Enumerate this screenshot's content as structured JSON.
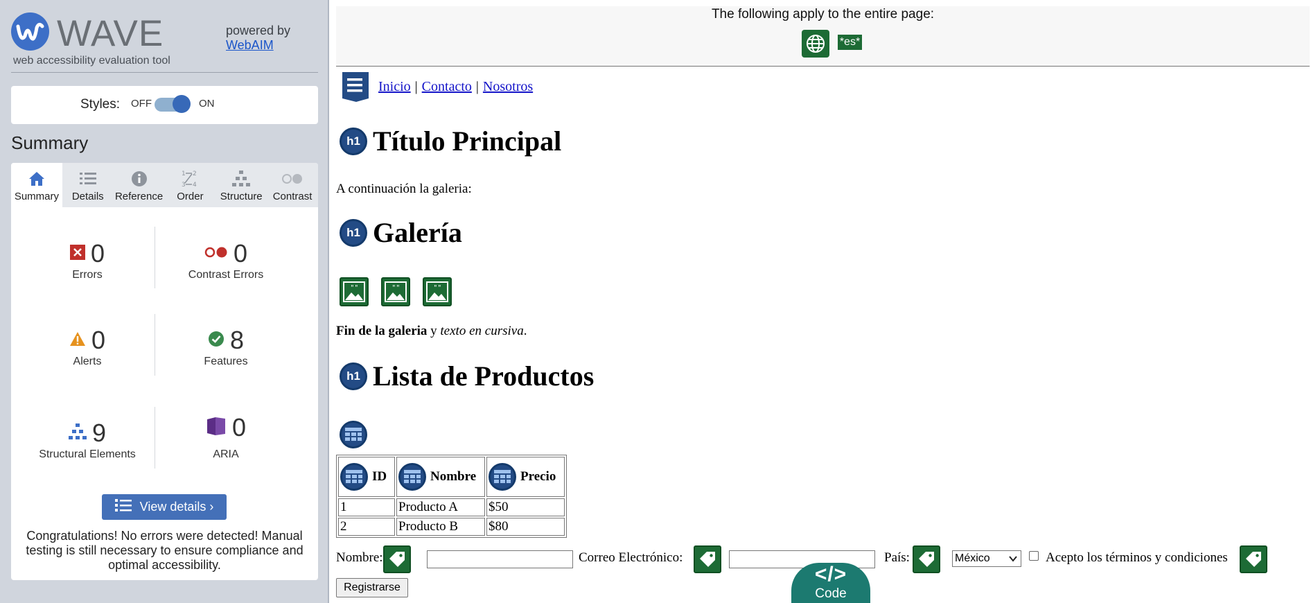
{
  "sidebar": {
    "logo_text": "WAVE",
    "tagline": "web accessibility evaluation tool",
    "powered_by": "powered by",
    "webaim_link": "WebAIM",
    "styles": {
      "label": "Styles:",
      "off": "OFF",
      "on": "ON",
      "state": "on"
    },
    "summary_heading": "Summary",
    "tabs": [
      {
        "label": "Summary",
        "icon": "home-icon",
        "active": true
      },
      {
        "label": "Details",
        "icon": "list-icon",
        "active": false
      },
      {
        "label": "Reference",
        "icon": "info-icon",
        "active": false
      },
      {
        "label": "Order",
        "icon": "order-icon",
        "active": false
      },
      {
        "label": "Structure",
        "icon": "structure-icon",
        "active": false
      },
      {
        "label": "Contrast",
        "icon": "contrast-icon",
        "active": false
      }
    ],
    "stats": {
      "errors": {
        "value": "0",
        "label": "Errors",
        "icon": "error-icon",
        "color": "#c0302b"
      },
      "contrast_errors": {
        "value": "0",
        "label": "Contrast Errors",
        "icon": "contrast-error-icon",
        "color": "#c0302b"
      },
      "alerts": {
        "value": "0",
        "label": "Alerts",
        "icon": "alert-icon",
        "color": "#e6921e"
      },
      "features": {
        "value": "8",
        "label": "Features",
        "icon": "feature-icon",
        "color": "#3a8a4e"
      },
      "structural": {
        "value": "9",
        "label": "Structural Elements",
        "icon": "structure-icon",
        "color": "#3d6fc7"
      },
      "aria": {
        "value": "0",
        "label": "ARIA",
        "icon": "aria-icon",
        "color": "#5b2d86"
      }
    },
    "view_details": "View details ›",
    "congrats": "Congratulations! No errors were detected! Manual testing is still necessary to ensure compliance and optimal accessibility."
  },
  "page": {
    "banner_text": "The following apply to the entire page:",
    "lang_badge": "*es*",
    "nav": [
      "Inicio",
      "Contacto",
      "Nosotros"
    ],
    "nav_separator": "|",
    "h1_icon_text": "h1",
    "heading_main": "Título Principal",
    "intro": "A continuación la galeria:",
    "heading_gallery": "Galería",
    "gallery_end_bold": "Fin de la galeria",
    "gallery_end_mid": " y ",
    "gallery_end_italic": "texto en cursiva",
    "gallery_end_tail": ".",
    "heading_products": "Lista de Productos",
    "table": {
      "headers": [
        "ID",
        "Nombre",
        "Precio"
      ],
      "rows": [
        [
          "1",
          "Producto A",
          "$50"
        ],
        [
          "2",
          "Producto B",
          "$80"
        ]
      ]
    },
    "form": {
      "nombre_label": "Nombre:",
      "correo_label": "Correo Electrónico:",
      "pais_label": "País:",
      "pais_value": "México",
      "terms_label": "Acepto los términos y condiciones",
      "submit_label": "Registrarse"
    },
    "code_glyph": "</>",
    "code_label": "Code"
  }
}
